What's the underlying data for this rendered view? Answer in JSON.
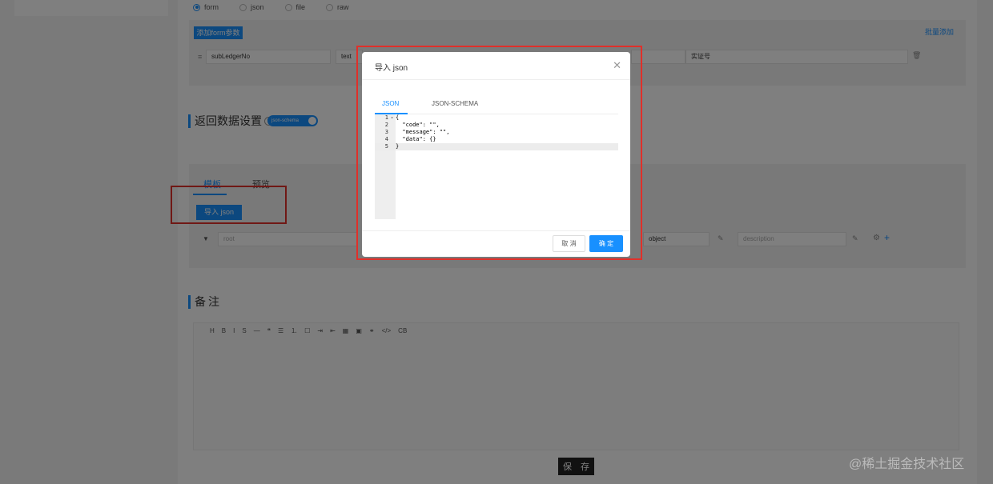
{
  "body_params": {
    "types": [
      "form",
      "json",
      "file",
      "raw"
    ],
    "selected_type": "form",
    "add_form_button": "添加form参数",
    "bulk_add_link": "批量添加",
    "row": {
      "name_value": "subLedgerNo",
      "type_value": "text",
      "description_value": "实证号"
    }
  },
  "response_section": {
    "title": "返回数据设置",
    "toggle_label": "json-schema",
    "tabs": [
      "模板",
      "预览"
    ],
    "import_json_button": "导入 json",
    "row": {
      "name_placeholder": "root",
      "type_value": "object",
      "description_placeholder": "description"
    }
  },
  "notes_section": {
    "title": "备注",
    "toolbar": [
      "H",
      "B",
      "I",
      "S",
      "—",
      "❝",
      "☰",
      "⒈",
      "☐",
      "⇥",
      "⇤",
      "▦",
      "▣",
      "⚭",
      "</>",
      "CB"
    ]
  },
  "save_button": "保 存",
  "watermark": "@稀土掘金技术社区",
  "modal": {
    "title": "导入 json",
    "tabs": [
      "JSON",
      "JSON-SCHEMA"
    ],
    "active_tab": "JSON",
    "code_lines": [
      {
        "no": "1",
        "fold": "▾",
        "text": "{"
      },
      {
        "no": "2",
        "fold": "",
        "text": "  \"code\": \"\","
      },
      {
        "no": "3",
        "fold": "",
        "text": "  \"message\": \"\","
      },
      {
        "no": "4",
        "fold": "",
        "text": "  \"data\": {}"
      },
      {
        "no": "5",
        "fold": "",
        "text": "}"
      }
    ],
    "cancel_button": "取 消",
    "ok_button": "确 定"
  },
  "colors": {
    "primary": "#1890ff",
    "highlight_border": "#e0302a",
    "save_button": "#222222"
  }
}
